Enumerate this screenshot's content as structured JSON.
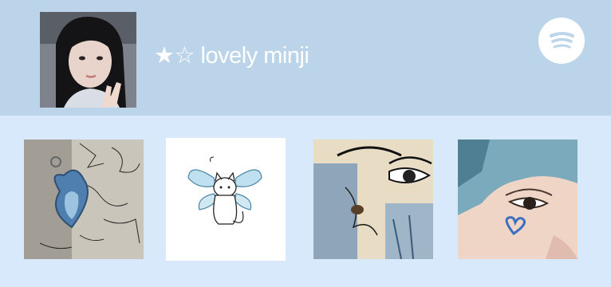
{
  "profile": {
    "title": "★☆ lovely minji",
    "avatar_icon": "profile-photo",
    "logo_icon": "spotify-icon"
  },
  "colors": {
    "header_bg": "#bcd4ea",
    "page_bg": "#d8e9fb",
    "title_text": "#ffffff"
  },
  "thumbnails": [
    {
      "name": "keychain-sketch-photo"
    },
    {
      "name": "winged-cat-drawing"
    },
    {
      "name": "painted-eye-artwork"
    },
    {
      "name": "blue-hair-heart-photo"
    }
  ]
}
